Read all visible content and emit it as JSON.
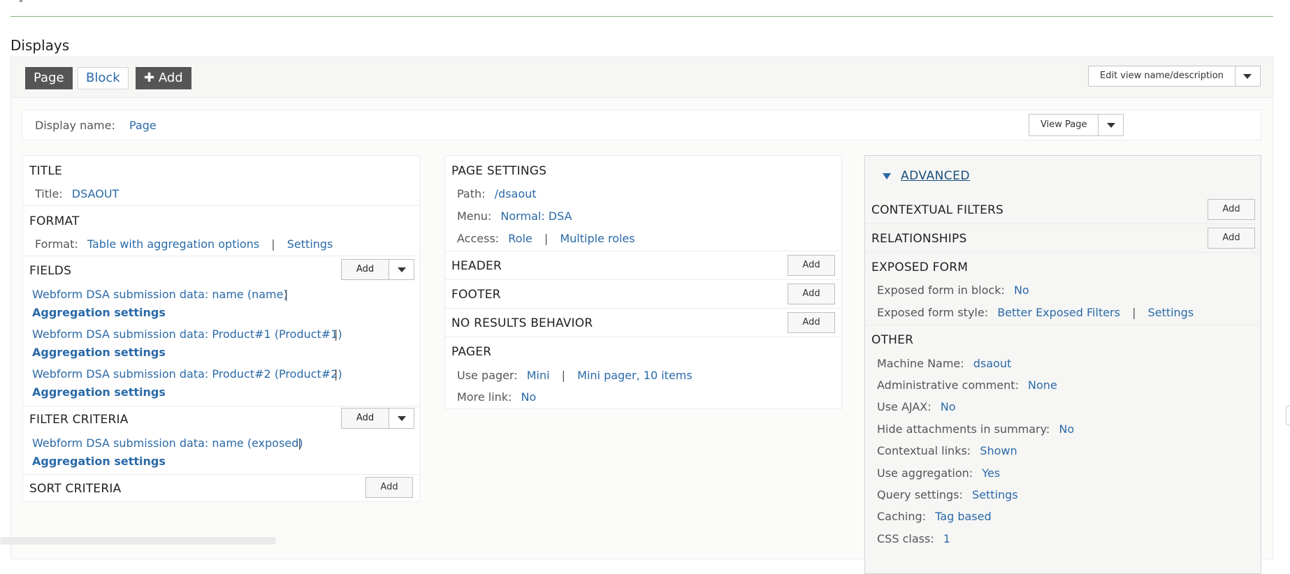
{
  "section_title": "Displays",
  "tabs": [
    {
      "label": "Page",
      "active": true
    },
    {
      "label": "Block",
      "active": false
    }
  ],
  "add_tab": {
    "icon": "plus-icon",
    "label": "Add"
  },
  "edit_view_button": "Edit view name/description",
  "display_name": {
    "label": "Display name:",
    "value": "Page"
  },
  "view_page_button": "View Page",
  "left_col": {
    "title_section": {
      "heading": "TITLE",
      "label": "Title:",
      "value": "DSAOUT"
    },
    "format_section": {
      "heading": "FORMAT",
      "label": "Format:",
      "value": "Table with aggregation options",
      "settings": "Settings"
    },
    "fields_section": {
      "heading": "FIELDS",
      "add": "Add",
      "items": [
        {
          "label": "Webform DSA submission data: name (name)",
          "agg": "Aggregation settings"
        },
        {
          "label": "Webform DSA submission data: Product#1 (Product#1)",
          "agg": "Aggregation settings"
        },
        {
          "label": "Webform DSA submission data: Product#2 (Product#2)",
          "agg": "Aggregation settings"
        }
      ]
    },
    "filter_section": {
      "heading": "FILTER CRITERIA",
      "add": "Add",
      "items": [
        {
          "label": "Webform DSA submission data: name (exposed)",
          "agg": "Aggregation settings"
        }
      ]
    },
    "sort_section": {
      "heading": "SORT CRITERIA",
      "add": "Add"
    }
  },
  "mid_col": {
    "page_settings": {
      "heading": "PAGE SETTINGS",
      "path_label": "Path:",
      "path_value": "/dsaout",
      "menu_label": "Menu:",
      "menu_value": "Normal: DSA",
      "access_label": "Access:",
      "access_value": "Role",
      "access_extra": "Multiple roles"
    },
    "header": {
      "heading": "HEADER",
      "add": "Add"
    },
    "footer": {
      "heading": "FOOTER",
      "add": "Add"
    },
    "no_results": {
      "heading": "NO RESULTS BEHAVIOR",
      "add": "Add"
    },
    "pager": {
      "heading": "PAGER",
      "use_label": "Use pager:",
      "use_value": "Mini",
      "use_extra": "Mini pager, 10 items",
      "more_label": "More link:",
      "more_value": "No"
    }
  },
  "advanced": {
    "toggle": "ADVANCED",
    "contextual": {
      "heading": "CONTEXTUAL FILTERS",
      "add": "Add"
    },
    "relationships": {
      "heading": "RELATIONSHIPS",
      "add": "Add"
    },
    "exposed": {
      "heading": "EXPOSED FORM",
      "block_label": "Exposed form in block:",
      "block_value": "No",
      "style_label": "Exposed form style:",
      "style_value": "Better Exposed Filters",
      "style_settings": "Settings"
    },
    "other": {
      "heading": "OTHER",
      "rows": [
        {
          "label": "Machine Name:",
          "value": "dsaout"
        },
        {
          "label": "Administrative comment:",
          "value": "None"
        },
        {
          "label": "Use AJAX:",
          "value": "No"
        },
        {
          "label": "Hide attachments in summary:",
          "value": "No"
        },
        {
          "label": "Contextual links:",
          "value": "Shown"
        },
        {
          "label": "Use aggregation:",
          "value": "Yes"
        },
        {
          "label": "Query settings:",
          "value": "Settings"
        },
        {
          "label": "Caching:",
          "value": "Tag based"
        },
        {
          "label": "CSS class:",
          "value": "1"
        }
      ]
    }
  },
  "colors": {
    "accent_link": "#2a6aa8",
    "active_tab": "#555555",
    "divider_green": "#86b57a"
  }
}
